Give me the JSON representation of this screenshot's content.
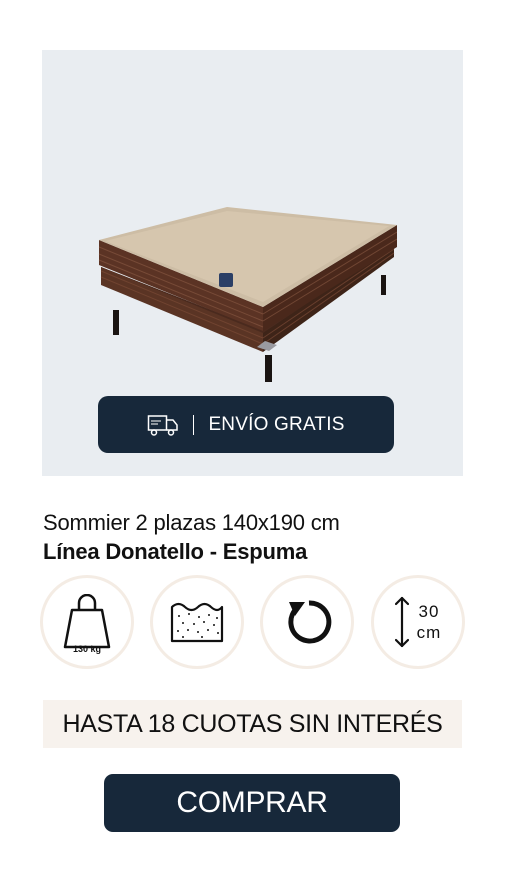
{
  "product": {
    "image_alt": "sommier-bed-photo",
    "shipping_badge": {
      "icon": "truck-icon",
      "label": "ENVÍO GRATIS"
    },
    "title_line1": "Sommier 2 plazas 140x190 cm",
    "title_line2": "Línea Donatello - Espuma"
  },
  "features": [
    {
      "icon": "weight-icon",
      "label": "130 kg"
    },
    {
      "icon": "foam-icon"
    },
    {
      "icon": "rotate-icon"
    },
    {
      "icon": "height-icon",
      "value": "30",
      "unit": "cm"
    }
  ],
  "financing_text": "HASTA 18 CUOTAS SIN INTERÉS",
  "buy_label": "COMPRAR",
  "colors": {
    "dark": "#17283a",
    "light_bg": "#e9edf1",
    "cream": "#f7f2ed"
  }
}
